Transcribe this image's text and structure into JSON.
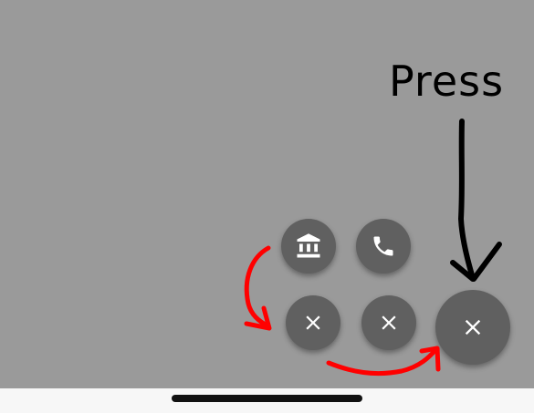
{
  "annotation": {
    "text": "Press"
  },
  "fab_menu": {
    "items": [
      {
        "icon": "bank-icon"
      },
      {
        "icon": "phone-icon"
      },
      {
        "icon": "close-icon"
      },
      {
        "icon": "close-icon"
      }
    ],
    "main": {
      "icon": "close-icon"
    }
  },
  "colors": {
    "scrim": "#9a9a9a",
    "fab": "#606060",
    "annotation_arrow_black": "#000000",
    "annotation_arrow_red": "#ff0000"
  }
}
